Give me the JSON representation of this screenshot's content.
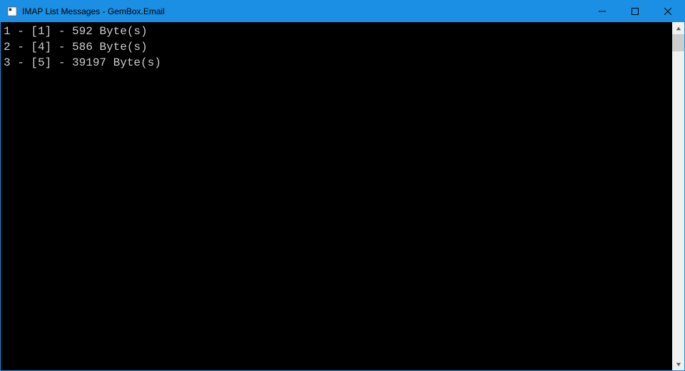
{
  "titlebar": {
    "title": "IMAP List Messages - GemBox.Email"
  },
  "console": {
    "lines": [
      {
        "seq": 1,
        "uid": 1,
        "size": 592,
        "unit": "Byte(s)"
      },
      {
        "seq": 2,
        "uid": 4,
        "size": 586,
        "unit": "Byte(s)"
      },
      {
        "seq": 3,
        "uid": 5,
        "size": 39197,
        "unit": "Byte(s)"
      }
    ]
  }
}
